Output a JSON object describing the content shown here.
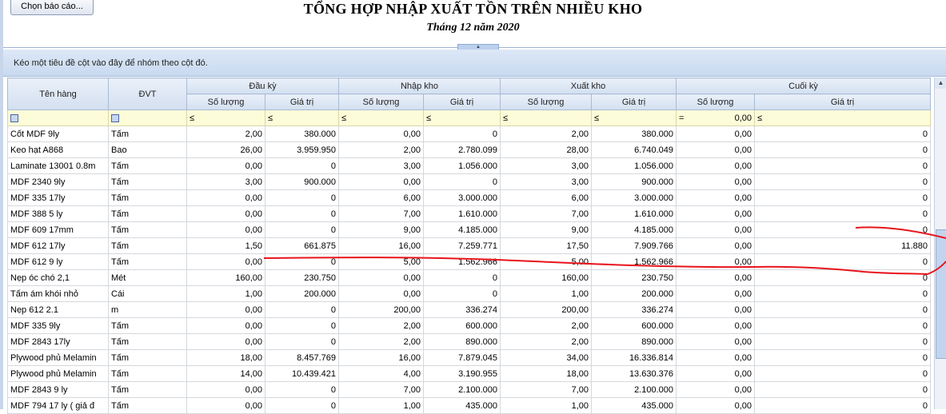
{
  "toolbar": {
    "choose_report_label": "Chọn báo cáo..."
  },
  "report": {
    "title": "TỔNG HỢP NHẬP XUẤT TỒN TRÊN NHIỀU KHO",
    "subtitle": "Tháng 12 năm 2020"
  },
  "group_panel": {
    "hint": "Kéo một tiêu đề cột vào đây để nhóm theo cột đó."
  },
  "columns": {
    "ten_hang": "Tên hàng",
    "dvt": "ĐVT",
    "groups": [
      "Đầu kỳ",
      "Nhập kho",
      "Xuất kho",
      "Cuối kỳ"
    ],
    "so_luong": "Số lượng",
    "gia_tri": "Giá trị"
  },
  "filter_row": {
    "op_le": "≤",
    "op_eq": "=",
    "cuoi_ky_so_luong_value": "0,00"
  },
  "rows": [
    [
      "Cốt MDF 9ly",
      "Tấm",
      "2,00",
      "380.000",
      "0,00",
      "0",
      "2,00",
      "380.000",
      "0,00",
      "0"
    ],
    [
      "Keo hạt A868",
      "Bao",
      "26,00",
      "3.959.950",
      "2,00",
      "2.780.099",
      "28,00",
      "6.740.049",
      "0,00",
      "0"
    ],
    [
      " Laminate 13001 0.8m",
      "Tấm",
      "0,00",
      "0",
      "3,00",
      "1.056.000",
      "3,00",
      "1.056.000",
      "0,00",
      "0"
    ],
    [
      "MDF 2340 9ly",
      "Tấm",
      "3,00",
      "900.000",
      "0,00",
      "0",
      "3,00",
      "900.000",
      "0,00",
      "0"
    ],
    [
      "MDF 335 17ly",
      "Tấm",
      "0,00",
      "0",
      "6,00",
      "3.000.000",
      "6,00",
      "3.000.000",
      "0,00",
      "0"
    ],
    [
      "MDF 388 5 ly",
      "Tấm",
      "0,00",
      "0",
      "7,00",
      "1.610.000",
      "7,00",
      "1.610.000",
      "0,00",
      "0"
    ],
    [
      " MDF 609 17mm",
      "Tấm",
      "0,00",
      "0",
      "9,00",
      "4.185.000",
      "9,00",
      "4.185.000",
      "0,00",
      "0"
    ],
    [
      "MDF 612 17ly",
      "Tấm",
      "1,50",
      "661.875",
      "16,00",
      "7.259.771",
      "17,50",
      "7.909.766",
      "0,00",
      "11.880"
    ],
    [
      "MDF 612 9 ly",
      "Tấm",
      "0,00",
      "0",
      "5,00",
      "1.562.966",
      "5,00",
      "1.562.966",
      "0,00",
      "0"
    ],
    [
      "Nẹp óc chó 2,1",
      "Mét",
      "160,00",
      "230.750",
      "0,00",
      "0",
      "160,00",
      "230.750",
      "0,00",
      "0"
    ],
    [
      "Tấm ám khói nhỏ",
      "Cái",
      "1,00",
      "200.000",
      "0,00",
      "0",
      "1,00",
      "200.000",
      "0,00",
      "0"
    ],
    [
      "Nẹp 612 2.1",
      "m",
      "0,00",
      "0",
      "200,00",
      "336.274",
      "200,00",
      "336.274",
      "0,00",
      "0"
    ],
    [
      "MDF 335 9ly",
      "Tấm",
      "0,00",
      "0",
      "2,00",
      "600.000",
      "2,00",
      "600.000",
      "0,00",
      "0"
    ],
    [
      "MDF 2843 17ly",
      "Tấm",
      "0,00",
      "0",
      "2,00",
      "890.000",
      "2,00",
      "890.000",
      "0,00",
      "0"
    ],
    [
      "Plywood phủ Melamin",
      "Tấm",
      "18,00",
      "8.457.769",
      "16,00",
      "7.879.045",
      "34,00",
      "16.336.814",
      "0,00",
      "0"
    ],
    [
      "Plywood phủ Melamin",
      "Tấm",
      "14,00",
      "10.439.421",
      "4,00",
      "3.190.955",
      "18,00",
      "13.630.376",
      "0,00",
      "0"
    ],
    [
      "MDF 2843 9 ly",
      "Tấm",
      "0,00",
      "0",
      "7,00",
      "2.100.000",
      "7,00",
      "2.100.000",
      "0,00",
      "0"
    ],
    [
      "MDF 794 17 ly  ( giả đ",
      "Tấm",
      "0,00",
      "0",
      "1,00",
      "435.000",
      "1,00",
      "435.000",
      "0,00",
      "0"
    ]
  ],
  "annotation": {
    "color": "#e8141c"
  },
  "icons": {
    "filter_checkbox": "filter-checkbox-icon",
    "collapse": "chevron-up-icon",
    "scroll_up": "scroll-up-arrow-icon"
  }
}
